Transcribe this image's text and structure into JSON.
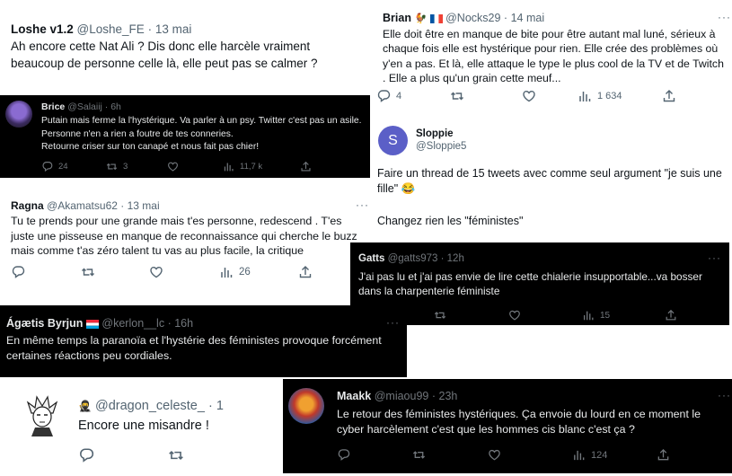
{
  "tweets": {
    "loshe": {
      "name": "Loshe v1.2",
      "handle": "@Loshe_FE",
      "sep": "·",
      "time": "13 mai",
      "text": "Ah encore cette Nat Ali ? Dis donc elle harcèle vraiment beaucoup de personne celle là, elle peut pas se calmer ?"
    },
    "brian": {
      "name": "Brian",
      "handle": "@Nocks29",
      "sep": "·",
      "time": "14 mai",
      "text": "Elle doit être en manque de bite pour être autant mal luné, sérieux à chaque fois elle est hystérique pour rien. Elle crée des problèmes où y'en a pas. Et là, elle attaque le type le plus cool de la TV et de Twitch . Elle a plus qu'un grain cette meuf...",
      "replies": "4",
      "views": "1 634",
      "more": "···"
    },
    "brice": {
      "name": "Brice",
      "handle": "@Salaiij",
      "sep": "·",
      "time": "6h",
      "text1": "Putain mais ferme la l'hystérique. Va parler à un psy. Twitter c'est pas un asile.",
      "text2": "Personne n'en a rien a foutre de tes conneries.",
      "text3": "Retourne criser sur ton canapé et nous fait pas chier!",
      "replies": "24",
      "retweets": "3",
      "views": "11,7 k"
    },
    "sloppie": {
      "name": "Sloppie",
      "handle": "@Sloppie5",
      "avatar_letter": "S",
      "text1": "Faire un thread de 15 tweets avec comme seul argument \"je suis une fille\" 😂",
      "text2": "Changez rien les \"féministes\""
    },
    "ragna": {
      "name": "Ragna",
      "handle": "@Akamatsu62",
      "sep": "·",
      "time": "13 mai",
      "text": "Tu te prends pour une grande mais t'es personne, redescend . T'es juste une pisseuse en manque de reconnaissance qui cherche le buzz mais comme t'as zéro talent tu vas au plus facile, la critique",
      "views": "26",
      "more": "···"
    },
    "gatts": {
      "name": "Gatts",
      "handle": "@gatts973",
      "sep": "·",
      "time": "12h",
      "text": "J'ai pas lu et j'ai pas envie de lire cette chialerie insupportable...va bosser dans la charpenterie féministe",
      "views": "15",
      "more": "···"
    },
    "agaetis": {
      "name": "Ágætis Byrjun",
      "handle": "@kerlon__lc",
      "sep": "·",
      "time": "16h",
      "text": "En même temps la paranoïa et l'hystérie des féministes provoque forcément certaines réactions peu cordiales.",
      "more": "···"
    },
    "dragon": {
      "handle": "@dragon_celeste_",
      "sep": "·",
      "time": "1",
      "text": "Encore une misandre !"
    },
    "maakk": {
      "name": "Maakk",
      "handle": "@miaou99",
      "sep": "·",
      "time": "23h",
      "text": "Le retour des féministes hystériques. Ça envoie du lourd en ce moment le cyber harcèlement c'est que les hommes cis blanc c'est ça ?",
      "views": "124",
      "more": "···"
    }
  },
  "colors": {
    "dark_bg": "#000000",
    "light_bg": "#ffffff",
    "muted_light": "#536471",
    "muted_dark": "#71767b",
    "avatar_s": "#5b5fc7"
  },
  "icons": [
    "reply-icon",
    "retweet-icon",
    "like-icon",
    "views-icon",
    "share-icon",
    "more-icon",
    "rooster-emoji-icon",
    "france-flag-icon",
    "luxembourg-flag-icon",
    "ninja-emoji-icon"
  ]
}
